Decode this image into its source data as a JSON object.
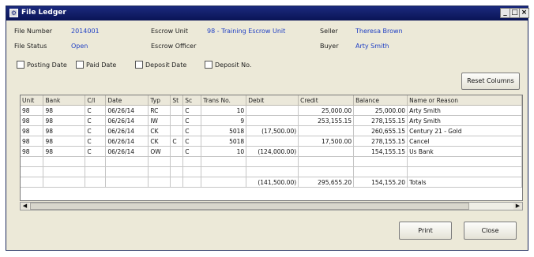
{
  "window": {
    "title": "File Ledger",
    "controls": {
      "minimize": "_",
      "maximize": "□",
      "close": "×"
    }
  },
  "info": {
    "file_number_label": "File Number",
    "file_number": "2014001",
    "file_status_label": "File Status",
    "file_status": "Open",
    "escrow_unit_label": "Escrow Unit",
    "escrow_unit": "98 - Training Escrow Unit",
    "escrow_officer_label": "Escrow Officer",
    "seller_label": "Seller",
    "seller": "Theresa Brown",
    "buyer_label": "Buyer",
    "buyer": "Arty Smith"
  },
  "filters": {
    "posting_date": "Posting Date",
    "paid_date": "Paid Date",
    "deposit_date": "Deposit Date",
    "deposit_no": "Deposit No."
  },
  "buttons": {
    "reset_columns": "Reset Columns",
    "print": "Print",
    "close": "Close"
  },
  "table": {
    "columns": [
      "Unit",
      "Bank",
      "C/I",
      "Date",
      "Typ",
      "St",
      "Sc",
      "Trans No.",
      "Debit",
      "Credit",
      "Balance",
      "Name or Reason"
    ],
    "rows": [
      [
        "98",
        "98",
        "C",
        "06/26/14",
        "RC",
        "",
        "C",
        "10",
        "",
        "25,000.00",
        "25,000.00",
        "Arty Smith"
      ],
      [
        "98",
        "98",
        "C",
        "06/26/14",
        "IW",
        "",
        "C",
        "9",
        "",
        "253,155.15",
        "278,155.15",
        "Arty Smith"
      ],
      [
        "98",
        "98",
        "C",
        "06/26/14",
        "CK",
        "",
        "C",
        "5018",
        "(17,500.00)",
        "",
        "260,655.15",
        "Century 21 - Gold"
      ],
      [
        "98",
        "98",
        "C",
        "06/26/14",
        "CK",
        "C",
        "C",
        "5018",
        "",
        "17,500.00",
        "278,155.15",
        "Cancel"
      ],
      [
        "98",
        "98",
        "C",
        "06/26/14",
        "OW",
        "",
        "C",
        "10",
        "(124,000.00)",
        "",
        "154,155.15",
        "Us Bank"
      ],
      [
        "",
        "",
        "",
        "",
        "",
        "",
        "",
        "",
        "",
        "",
        "",
        ""
      ],
      [
        "",
        "",
        "",
        "",
        "",
        "",
        "",
        "",
        "",
        "",
        "",
        ""
      ],
      [
        "",
        "",
        "",
        "",
        "",
        "",
        "",
        "",
        "(141,500.00)",
        "295,655.20",
        "154,155.20",
        "Totals"
      ]
    ]
  },
  "scrollbar": {
    "left_arrow": "◀",
    "right_arrow": "▶"
  },
  "colors": {
    "title_bar": "#0a1455",
    "value_text": "#1f3fc4",
    "window_bg": "#ece9d8"
  }
}
